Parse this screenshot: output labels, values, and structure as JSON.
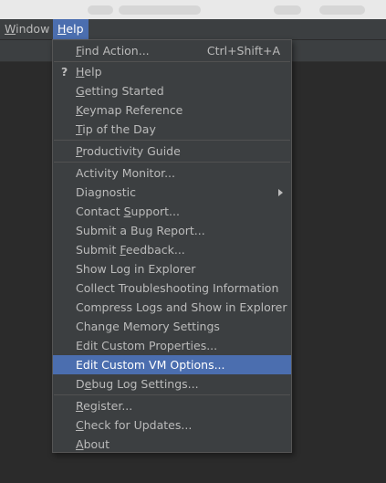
{
  "menubar": {
    "window": {
      "pre": "",
      "mn": "W",
      "post": "indow"
    },
    "help": {
      "pre": "",
      "mn": "H",
      "post": "elp"
    }
  },
  "help_menu": {
    "find_action": {
      "pre": "",
      "mn": "F",
      "post": "ind Action...",
      "shortcut": "Ctrl+Shift+A"
    },
    "help": {
      "icon": "?",
      "pre": "",
      "mn": "H",
      "post": "elp"
    },
    "getting_started": {
      "pre": "",
      "mn": "G",
      "post": "etting Started"
    },
    "keymap_reference": {
      "pre": "",
      "mn": "K",
      "post": "eymap Reference"
    },
    "tip_of_the_day": {
      "pre": "",
      "mn": "T",
      "post": "ip of the Day"
    },
    "productivity_guide": {
      "pre": "",
      "mn": "P",
      "post": "roductivity Guide"
    },
    "activity_monitor": {
      "pre": "Activity Monitor...",
      "mn": "",
      "post": ""
    },
    "diagnostic": {
      "pre": "Diagnostic",
      "mn": "",
      "post": "",
      "submenu_icon": "chevron-right-icon"
    },
    "contact_support": {
      "pre": "Contact ",
      "mn": "S",
      "post": "upport..."
    },
    "submit_bug_report": {
      "pre": "Submit a Bug Report...",
      "mn": "",
      "post": ""
    },
    "submit_feedback": {
      "pre": "Submit ",
      "mn": "F",
      "post": "eedback..."
    },
    "show_log": {
      "pre": "Show Log in Explorer",
      "mn": "",
      "post": ""
    },
    "collect_troubleshooting": {
      "pre": "Collect Troubleshooting Information",
      "mn": "",
      "post": ""
    },
    "compress_logs": {
      "pre": "Compress Logs and Show in Explorer",
      "mn": "",
      "post": ""
    },
    "change_memory": {
      "pre": "Change Memory Settings",
      "mn": "",
      "post": ""
    },
    "edit_custom_properties": {
      "pre": "Edit Custom Properties...",
      "mn": "",
      "post": ""
    },
    "edit_custom_vm_options": {
      "pre": "Edit Custom VM Options...",
      "mn": "",
      "post": ""
    },
    "debug_log_settings": {
      "pre": "D",
      "mn": "e",
      "post": "bug Log Settings..."
    },
    "register": {
      "pre": "",
      "mn": "R",
      "post": "egister..."
    },
    "check_for_updates": {
      "pre": "",
      "mn": "C",
      "post": "heck for Updates..."
    },
    "about": {
      "pre": "",
      "mn": "A",
      "post": "bout"
    }
  },
  "colors": {
    "menu_background": "#3c3f41",
    "selection": "#4b6eaf",
    "text": "#bbbbbb",
    "editor_background": "#2b2b2b"
  }
}
